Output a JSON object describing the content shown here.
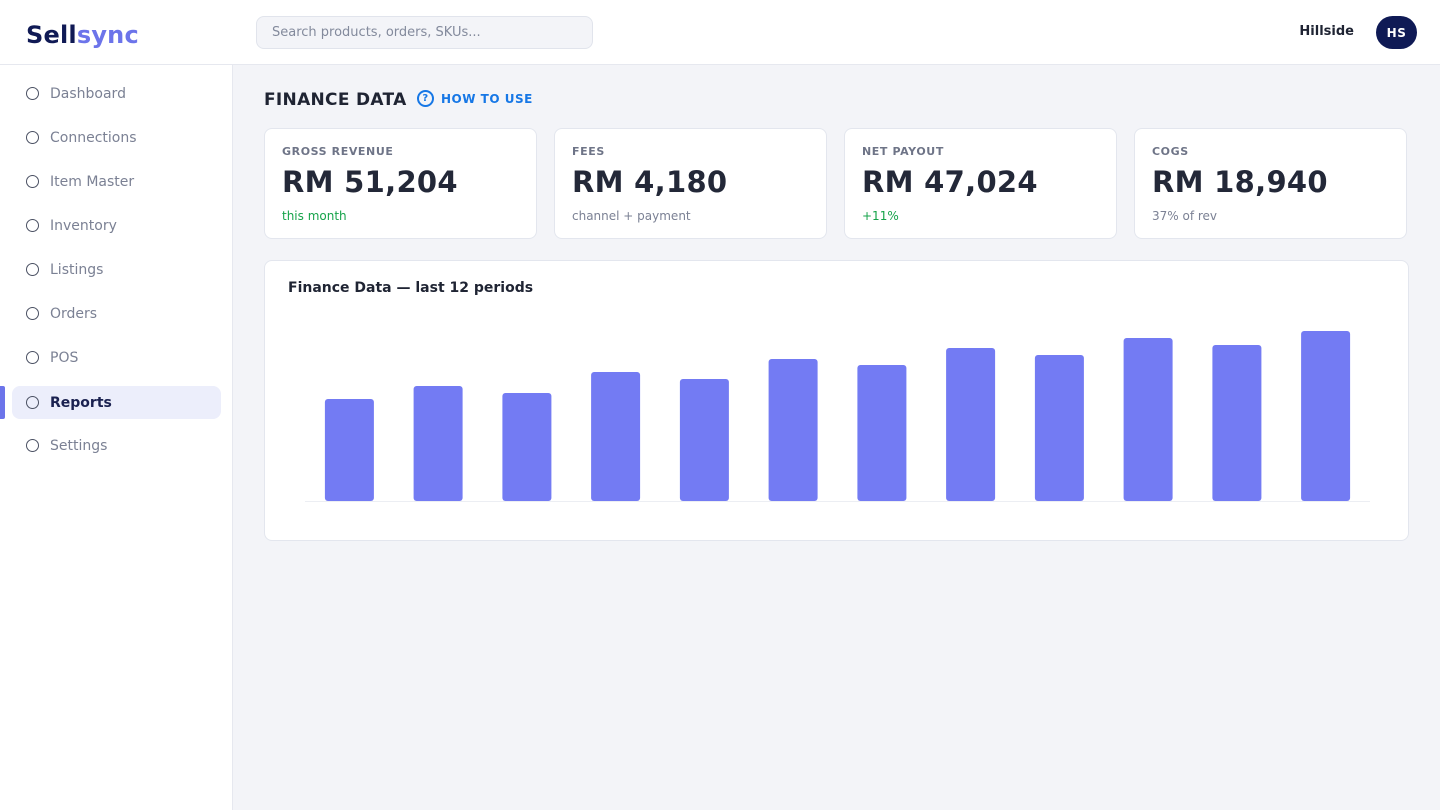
{
  "app": {
    "logo_part1": "Sell",
    "logo_part2": "sync"
  },
  "header": {
    "search_placeholder": "Search products, orders, SKUs...",
    "store_name": "Hillside",
    "avatar_initials": "HS"
  },
  "sidebar": {
    "items": [
      {
        "label": "Dashboard",
        "icon": "circle-icon"
      },
      {
        "label": "Connections",
        "icon": "circle-icon"
      },
      {
        "label": "Item Master",
        "icon": "circle-icon"
      },
      {
        "label": "Inventory",
        "icon": "circle-icon"
      },
      {
        "label": "Listings",
        "icon": "circle-icon"
      },
      {
        "label": "Orders",
        "icon": "circle-icon"
      },
      {
        "label": "POS",
        "icon": "circle-icon"
      },
      {
        "label": "Reports",
        "icon": "circle-icon",
        "active": true
      },
      {
        "label": "Settings",
        "icon": "circle-icon"
      }
    ]
  },
  "page": {
    "title": "FINANCE DATA",
    "how_to_label": "HOW TO USE",
    "how_to_icon": "question-icon"
  },
  "cards": [
    {
      "label": "GROSS REVENUE",
      "value": "RM 51,204",
      "sub": "this month",
      "sub_tone": "green"
    },
    {
      "label": "FEES",
      "value": "RM 4,180",
      "sub": "channel + payment",
      "sub_tone": "gray"
    },
    {
      "label": "NET PAYOUT",
      "value": "RM 47,024",
      "sub": "+11%",
      "sub_tone": "green"
    },
    {
      "label": "COGS",
      "value": "RM 18,940",
      "sub": "37% of rev",
      "sub_tone": "gray"
    }
  ],
  "colors": {
    "accent": "#6c74ea",
    "bar": "#737bf3",
    "brand_dark": "#0f1a55",
    "positive": "#16a34a",
    "link": "#1677e6"
  },
  "chart_data": {
    "type": "bar",
    "title": "Finance Data — last 12 periods",
    "categories": [
      "",
      "",
      "",
      "",
      "",
      "",
      "",
      "",
      "",
      "",
      "",
      ""
    ],
    "values": [
      102,
      115,
      108,
      129,
      122,
      142,
      136,
      153,
      146,
      163,
      156,
      170
    ],
    "ylim": [
      0,
      190
    ],
    "xlabel": "",
    "ylabel": "",
    "grid": false,
    "legend": "none"
  }
}
